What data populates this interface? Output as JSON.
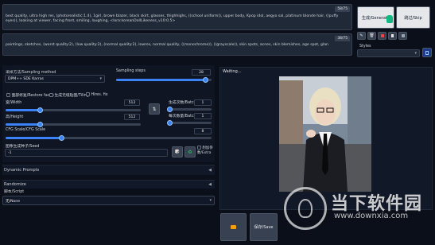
{
  "prompt": {
    "positive": "best quality, ultra high res, (photorealistic:1.4), 1girl, brown blazer, black skirt, glasses, thighhighs, ((school uniform)), upper body, Kpop idol, aegyo sal, platinum blonde hair, ((puffy eyes)), looking at viewer, facing front, smiling, laughing, <lora:koreanDollLikeness_v10:0.5>",
    "positive_count": "58/75",
    "negative": "paintings, sketches, (worst quality:2), (low quality:2), (normal quality:2), lowres, normal quality, ((monochrome)), ((grayscale)), skin spots, acnes, skin blemishes, age spot, glan",
    "negative_count": "38/75"
  },
  "actions": {
    "generate_label": "生成/Generate",
    "skip_label": "跳过/Skip",
    "styles_label": "Styles",
    "tool_icons": [
      "pencil-icon",
      "trash-icon",
      "red-square-icon",
      "clipboard-icon",
      "save-icon"
    ]
  },
  "sampling": {
    "method_label": "采样方法/Sampling method",
    "method_value": "DPM++ SDE Karras",
    "steps_label": "Sampling steps",
    "steps_value": "28",
    "steps_fraction": 0.93
  },
  "options": {
    "restore_faces": "面部修复/Restore faces",
    "tiling": "生成无缝贴图/Tiling",
    "hires_fix": "Hires. fix"
  },
  "size": {
    "width_label": "宽/Width",
    "width_value": "512",
    "width_fraction": 0.25,
    "height_label": "高/Height",
    "height_value": "512",
    "height_fraction": 0.25,
    "swap_icon": "⇅",
    "batch_count_label": "生成次数/Batch c",
    "batch_count_value": "1",
    "batch_size_label": "每次数量/Batch s",
    "batch_size_value": "1"
  },
  "cfg": {
    "label": "CFG Scale/CFG Scale",
    "value": "8",
    "fraction": 0.27
  },
  "seed": {
    "label": "图像生成种子/Seed",
    "value": "-1",
    "dice_icon": "🎲",
    "recycle_icon": "♻",
    "extra_label_1": "附加参",
    "extra_label_2": "数/Extra"
  },
  "sections": {
    "dynamic_prompts": "Dynamic Prompts",
    "randomize": "Randomize",
    "script_label": "脚本/Script",
    "script_value": "无/None"
  },
  "output": {
    "status": "Waiting...",
    "image_name": "generated-portrait",
    "save_label": "保存/Save"
  },
  "watermark": {
    "brand": "当下软件园",
    "url": "www.downxia.com"
  }
}
